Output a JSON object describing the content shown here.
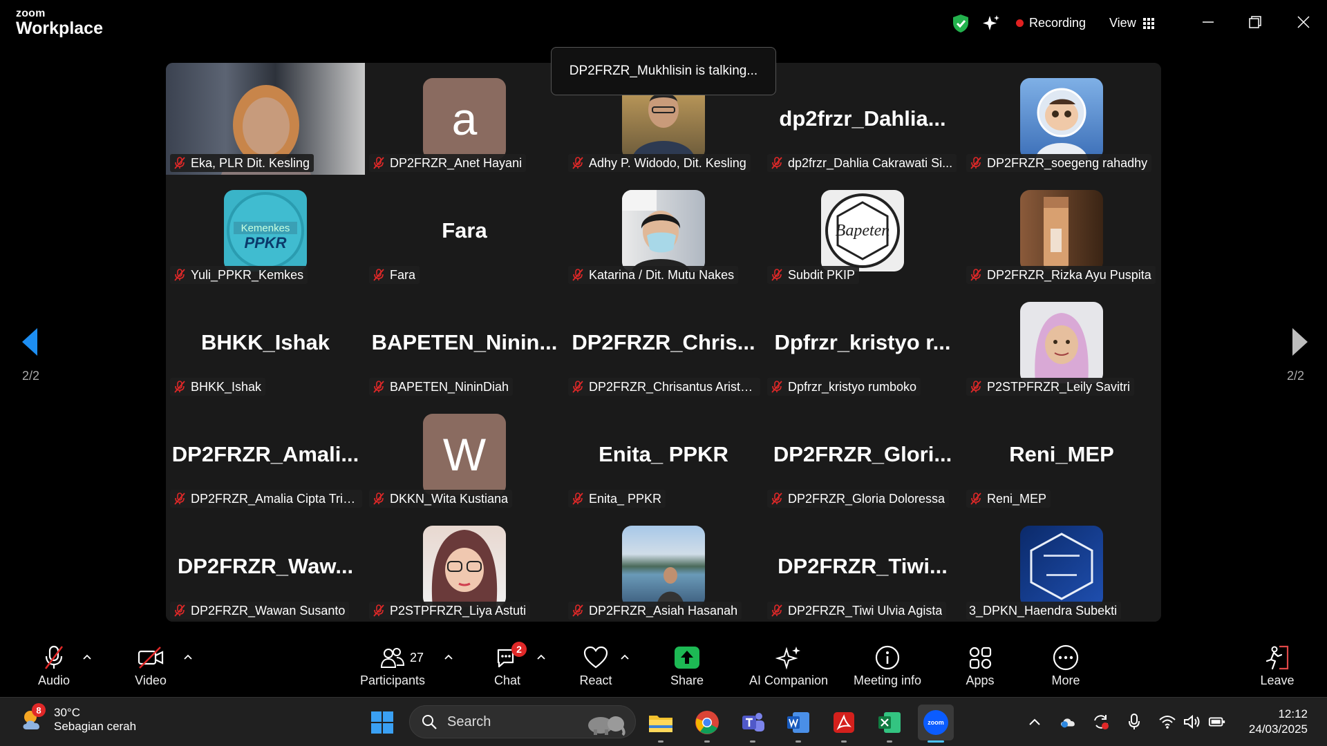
{
  "app": {
    "brand_small": "zoom",
    "brand_big": "Workplace"
  },
  "header": {
    "recording": "Recording",
    "view": "View"
  },
  "talking": "DP2FRZR_Mukhlisin is talking...",
  "pages": {
    "left": "2/2",
    "right": "2/2"
  },
  "tiles": [
    {
      "label": "Eka, PLR Dit. Kesling",
      "display": "",
      "type": "video"
    },
    {
      "label": "DP2FRZR_Anet Hayani",
      "display": "a",
      "type": "letter",
      "color": "#8a6b60"
    },
    {
      "label": "Adhy P. Widodo, Dit. Kesling",
      "display": "",
      "type": "photo-man"
    },
    {
      "label": "dp2frzr_Dahlia Cakrawati Si...",
      "display": "dp2frzr_Dahlia...",
      "type": "name"
    },
    {
      "label": "DP2FRZR_soegeng rahadhy",
      "display": "",
      "type": "photo-astro"
    },
    {
      "label": "Yuli_PPKR_Kemkes",
      "display": "",
      "type": "logo-ppkr"
    },
    {
      "label": "Fara",
      "display": "Fara",
      "type": "name"
    },
    {
      "label": "Katarina / Dit. Mutu Nakes",
      "display": "",
      "type": "photo-mask"
    },
    {
      "label": "Subdit PKIP",
      "display": "",
      "type": "logo-bapeten"
    },
    {
      "label": "DP2FRZR_Rizka Ayu Puspita",
      "display": "",
      "type": "photo-bottle"
    },
    {
      "label": "BHKK_Ishak",
      "display": "BHKK_Ishak",
      "type": "name"
    },
    {
      "label": "BAPETEN_NininDiah",
      "display": "BAPETEN_Ninin...",
      "type": "name"
    },
    {
      "label": "DP2FRZR_Chrisantus Aristo ...",
      "display": "DP2FRZR_Chris...",
      "type": "name"
    },
    {
      "label": "Dpfrzr_kristyo rumboko",
      "display": "Dpfrzr_kristyo r...",
      "type": "name"
    },
    {
      "label": "P2STPFRZR_Leily Savitri",
      "display": "",
      "type": "photo-hijab"
    },
    {
      "label": "DP2FRZR_Amalia Cipta Triku...",
      "display": "DP2FRZR_Amali...",
      "type": "name"
    },
    {
      "label": "DKKN_Wita Kustiana",
      "display": "W",
      "type": "letter",
      "color": "#8a6b60"
    },
    {
      "label": "Enita_ PPKR",
      "display": "Enita_ PPKR",
      "type": "name"
    },
    {
      "label": "DP2FRZR_Gloria Doloressa",
      "display": "DP2FRZR_Glori...",
      "type": "name"
    },
    {
      "label": "Reni_MEP",
      "display": "Reni_MEP",
      "type": "name"
    },
    {
      "label": "DP2FRZR_Wawan Susanto",
      "display": "DP2FRZR_Waw...",
      "type": "name"
    },
    {
      "label": "P2STPFRZR_Liya Astuti",
      "display": "",
      "type": "photo-glasses"
    },
    {
      "label": "DP2FRZR_Asiah Hasanah",
      "display": "",
      "type": "photo-lake"
    },
    {
      "label": "DP2FRZR_Tiwi Ulvia Agista",
      "display": "DP2FRZR_Tiwi...",
      "type": "name"
    },
    {
      "label": "3_DPKN_Haendra Subekti",
      "display": "",
      "type": "logo-hex",
      "unmuted": true
    }
  ],
  "toolbar": {
    "audio": "Audio",
    "video": "Video",
    "participants": "Participants",
    "participants_count": "27",
    "chat": "Chat",
    "chat_badge": "2",
    "react": "React",
    "share": "Share",
    "ai": "AI Companion",
    "info": "Meeting info",
    "apps": "Apps",
    "more": "More",
    "leave": "Leave"
  },
  "taskbar": {
    "weather_badge": "8",
    "temp": "30°C",
    "condition": "Sebagian cerah",
    "search": "Search",
    "time": "12:12",
    "date": "24/03/2025"
  },
  "colors": {
    "accent_blue": "#0e72ed",
    "share_green": "#1db954",
    "mute_red": "#e02828"
  },
  "logo_texts": {
    "ppkr": "PPKR",
    "kemenkes": "Kemenkes",
    "bapeten": "Bapeten",
    "zoom_icon": "zoom"
  }
}
